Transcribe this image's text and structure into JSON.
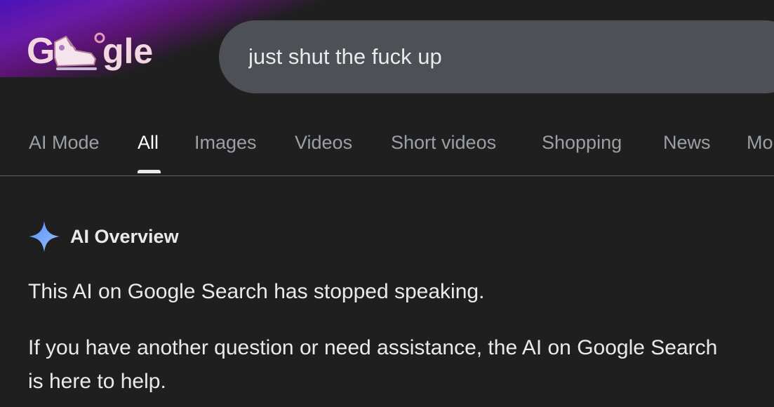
{
  "search": {
    "query": "just shut the fuck up"
  },
  "tabs": [
    {
      "label": "AI Mode",
      "active": false
    },
    {
      "label": "All",
      "active": true
    },
    {
      "label": "Images",
      "active": false
    },
    {
      "label": "Videos",
      "active": false
    },
    {
      "label": "Short videos",
      "active": false
    },
    {
      "label": "Shopping",
      "active": false
    },
    {
      "label": "News",
      "active": false
    },
    {
      "label": "Mo",
      "active": false
    }
  ],
  "ai_overview": {
    "title": "AI Overview",
    "paragraphs": [
      "This AI on Google Search has stopped speaking.",
      "If you have another question or need assistance, the AI on Google Search is here to help."
    ]
  },
  "colors": {
    "background": "#1f1f1f",
    "search_bar": "#4d5156",
    "tab_inactive": "#9aa0a6",
    "tab_active": "#ffffff",
    "sparkle": "#8ab4f8"
  },
  "icons": {
    "logo": "google-doodle-logo",
    "ai_overview": "sparkle-icon"
  }
}
